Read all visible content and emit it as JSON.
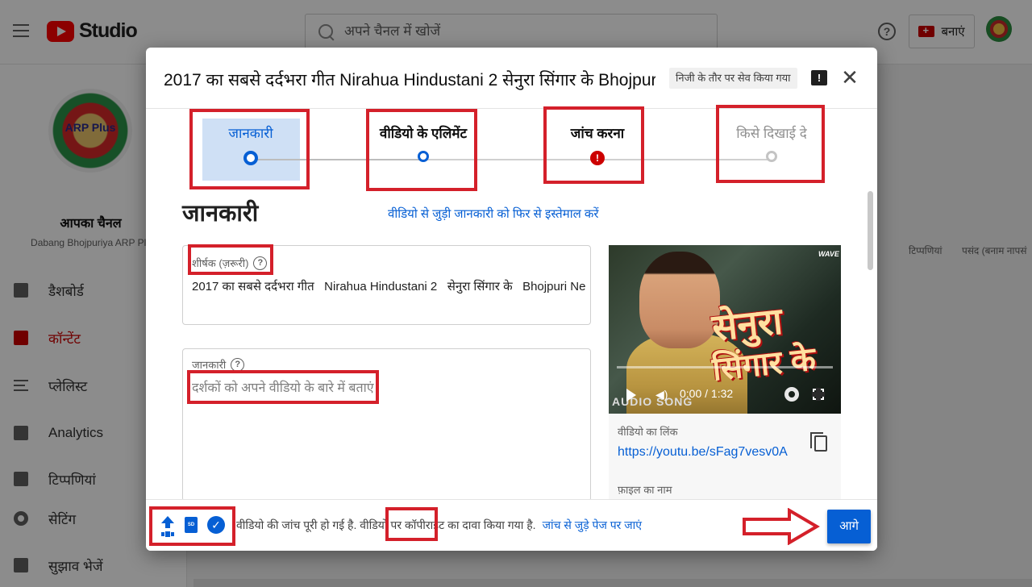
{
  "header": {
    "app_name": "Studio",
    "search": {
      "placeholder": "अपने चैनल में खोजें"
    },
    "help_icon": "?",
    "create_label": "बनाएं"
  },
  "sidebar": {
    "channel_title": "आपका चैनल",
    "channel_name": "Dabang Bhojpuriya ARP Plus",
    "avatar_text": "ARP Plus",
    "items": [
      {
        "label": "डैशबोर्ड",
        "icon": "dashboard-icon"
      },
      {
        "label": "कॉन्टेंट",
        "icon": "content-icon",
        "active": true
      },
      {
        "label": "प्लेलिस्ट",
        "icon": "playlist-icon"
      },
      {
        "label": "Analytics",
        "icon": "analytics-icon"
      },
      {
        "label": "टिप्पणियां",
        "icon": "comments-icon"
      },
      {
        "label": "सेटिंग",
        "icon": "settings-icon"
      },
      {
        "label": "सुझाव भेजें",
        "icon": "feedback-icon"
      }
    ]
  },
  "background_table": {
    "col_comments": "टिप्पणियां",
    "col_likes": "पसंद (बनाम नापसं"
  },
  "modal": {
    "title": "2017 का सबसे दर्दभरा गीत Nirahua Hindustani 2 सेनुरा सिंगार के Bhojpuri Ne",
    "saved_status": "निजी के तौर पर सेव किया गया",
    "feedback_icon": "!",
    "close_icon": "✕",
    "steps": [
      {
        "label": "जानकारी",
        "state": "current"
      },
      {
        "label": "वीडियो के एलिमेंट",
        "state": "done"
      },
      {
        "label": "जांच करना",
        "state": "error",
        "marker": "!"
      },
      {
        "label": "किसे दिखाई दे",
        "state": "pending"
      }
    ],
    "section_title": "जानकारी",
    "reuse_link": "वीडियो से जुड़ी जानकारी को फिर से इस्तेमाल करें",
    "title_field": {
      "label": "शीर्षक (ज़रूरी)",
      "help": "?",
      "value": "2017 का सबसे दर्दभरा गीत   Nirahua Hindustani 2   सेनुरा सिंगार के   Bhojpuri Ne"
    },
    "description_field": {
      "label": "जानकारी",
      "help": "?",
      "placeholder": "दर्शकों को अपने वीडियो के बारे में बताएं"
    },
    "video": {
      "overlay_title_1": "सेनुरा",
      "overlay_title_2": "सिंगार के",
      "audio_label": "AUDIO SONG",
      "badge": "WAVE",
      "time": "0:00 / 1:32",
      "link_label": "वीडियो का लिंक",
      "link_value": "https://youtu.be/sFag7vesv0A",
      "file_label": "फ़ाइल का नाम"
    },
    "footer": {
      "sd_label": "SD",
      "check_icon": "✓",
      "status_text": "वीडियो की जांच पूरी हो गई है. वीडियो पर कॉपीराइट का दावा किया गया है.",
      "status_link": "जांच से जुड़े पेज पर जाएं",
      "next_label": "आगे"
    },
    "annotation_color": "#d4202a",
    "accent_color": "#065fd4"
  }
}
